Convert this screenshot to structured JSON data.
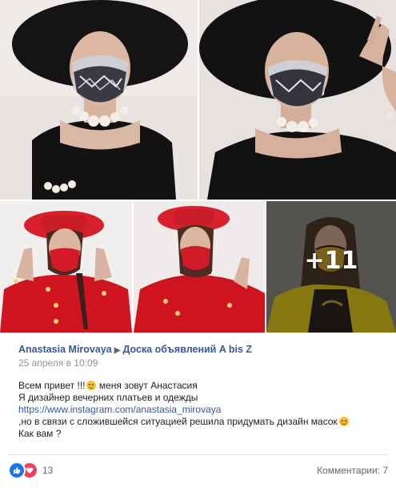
{
  "photos": {
    "more_count": "+11"
  },
  "post": {
    "author": "Anastasia Mirovaya",
    "group": "Доска объявлений A bis Z",
    "date": "25 апреля в 10:09",
    "lines": [
      "Всем привет !!!",
      "меня зовут Анастасия",
      "Я дизайнер вечерних платьев и одежды",
      "https://www.instagram.com/anastasia_mirovaya",
      ",но в связи с сложившейся ситуацией решила придумать дизайн масок",
      "Как вам ?"
    ]
  },
  "footer": {
    "reactions_count": "13",
    "comments_label": "Комментарии: 7"
  },
  "colors": {
    "link": "#385898",
    "like": "#1877f2",
    "love": "#f33e58"
  }
}
